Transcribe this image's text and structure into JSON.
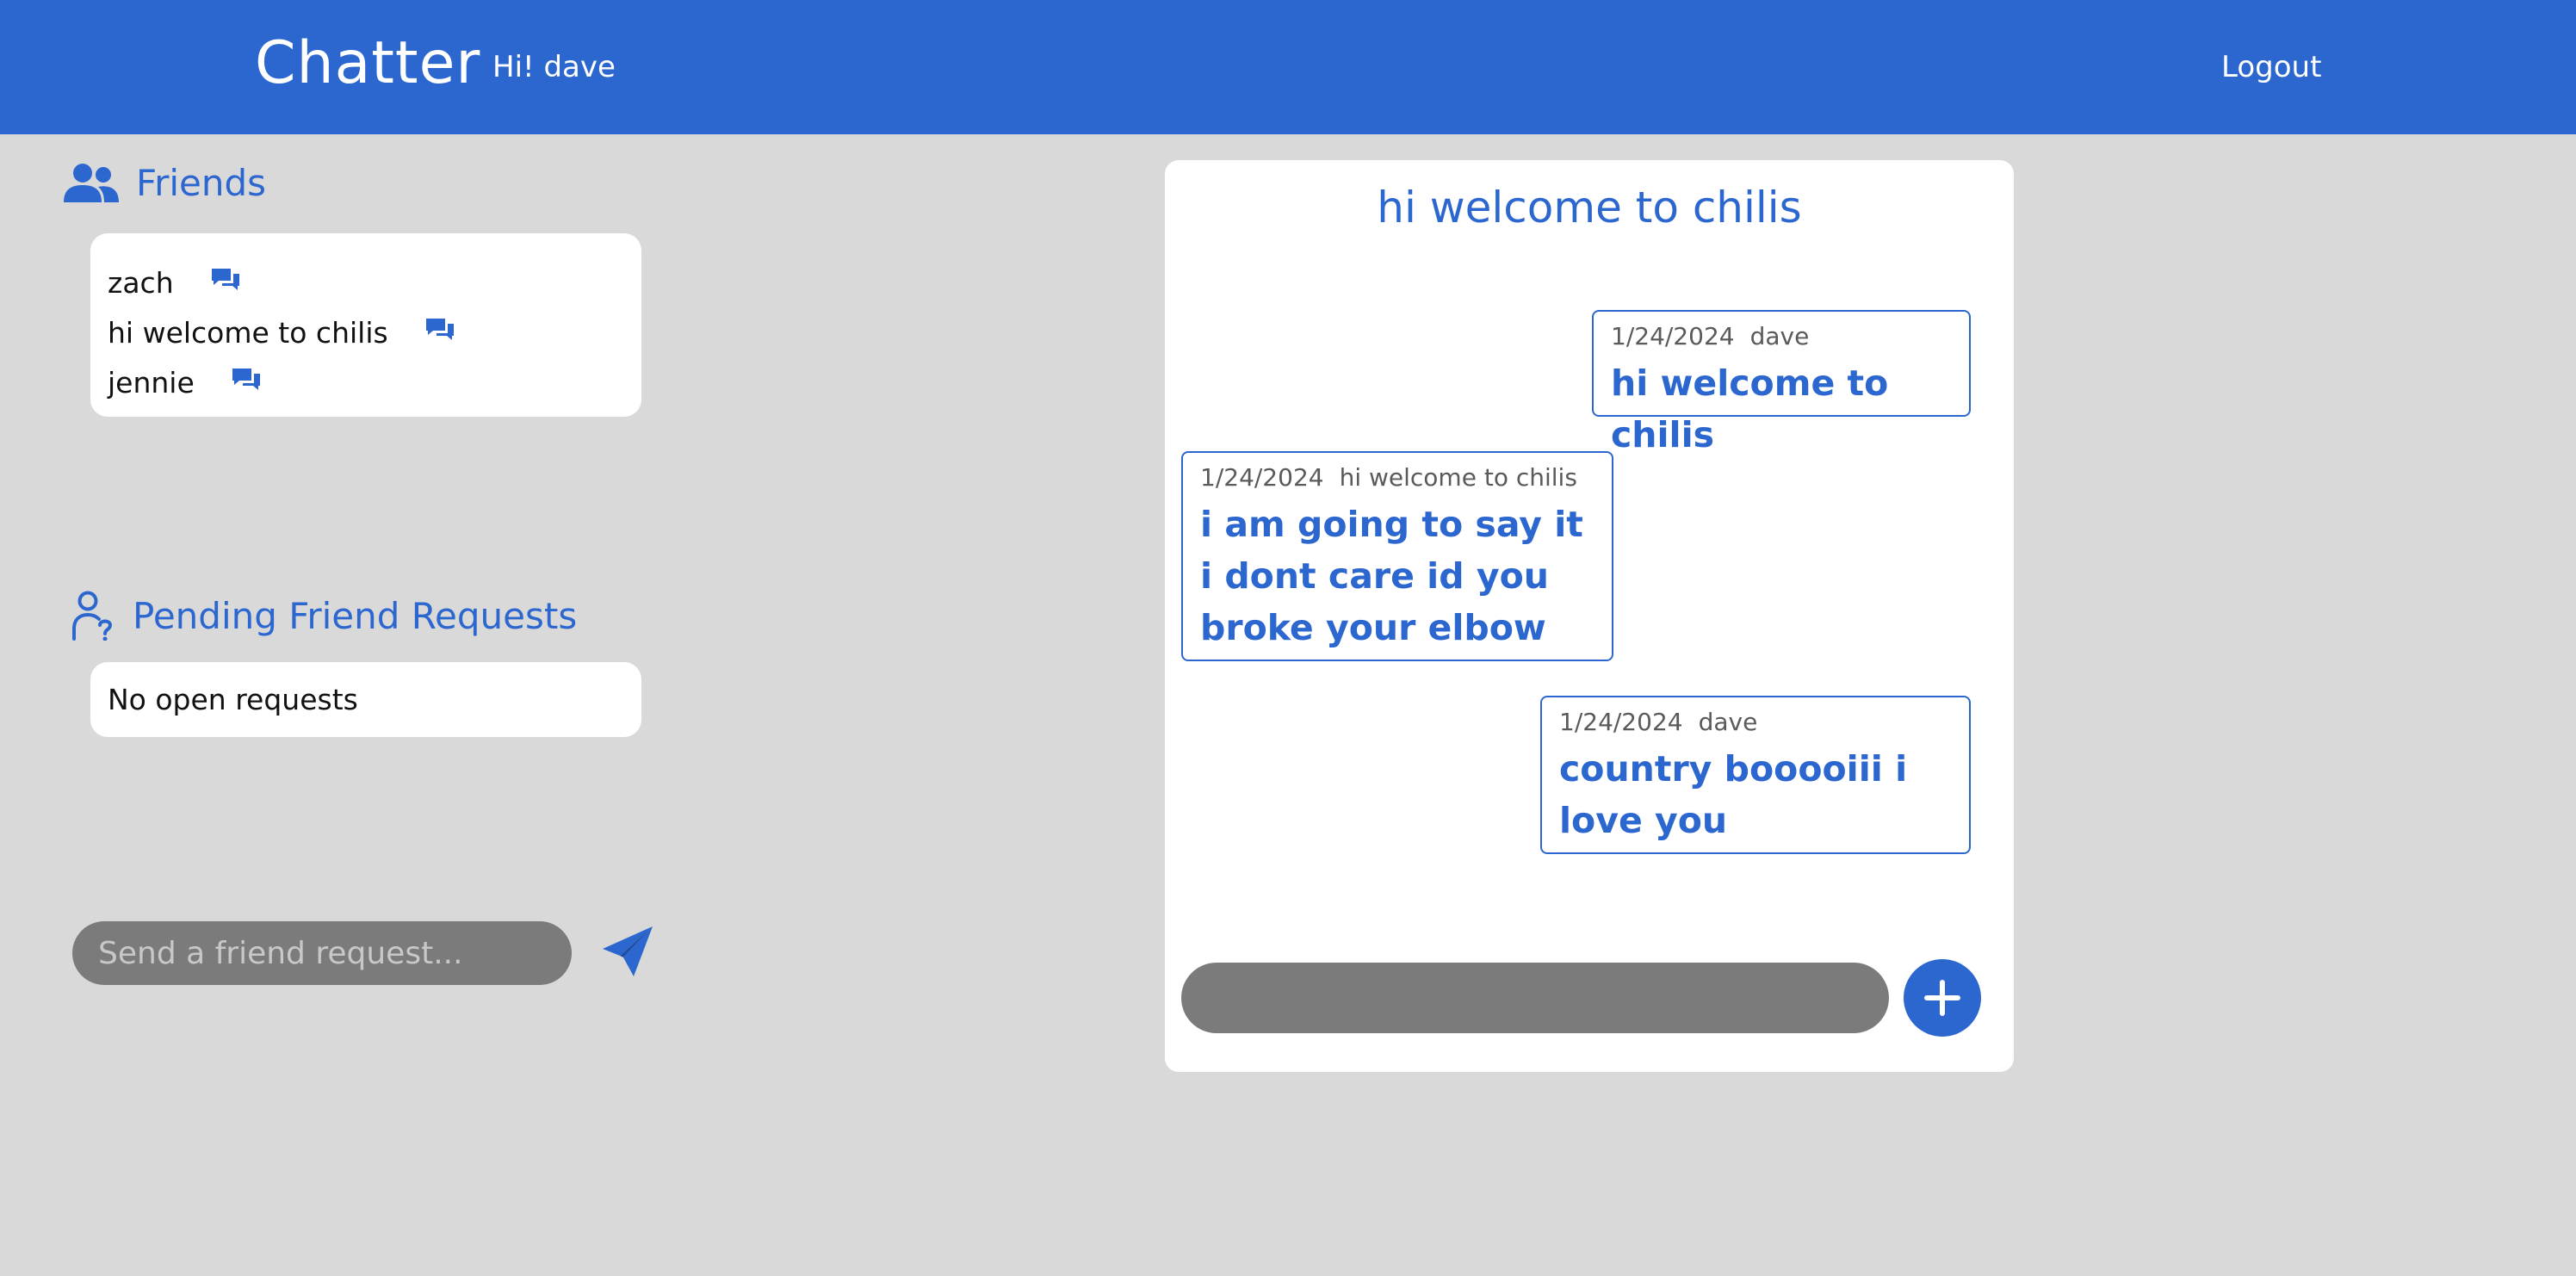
{
  "header": {
    "brand": "Chatter",
    "greeting": "Hi! dave",
    "logout_label": "Logout"
  },
  "friends": {
    "title": "Friends",
    "items": [
      {
        "name": "zach"
      },
      {
        "name": "hi welcome to chilis"
      },
      {
        "name": "jennie"
      }
    ]
  },
  "pending": {
    "title": "Pending Friend Requests",
    "empty_text": "No open requests"
  },
  "friend_request": {
    "placeholder": "Send a friend request..."
  },
  "chat": {
    "title": "hi welcome to chilis",
    "messages": [
      {
        "date": "1/24/2024",
        "sender": "dave",
        "text": "hi welcome to chilis"
      },
      {
        "date": "1/24/2024",
        "sender": "hi welcome to chilis",
        "text": "i am going to say it i dont care id you broke your elbow"
      },
      {
        "date": "1/24/2024",
        "sender": "dave",
        "text": "country booooiii i love you"
      }
    ],
    "input_value": ""
  },
  "colors": {
    "accent": "#2c67d0",
    "background": "#d9d9d9",
    "input_gray": "#7b7b7b"
  },
  "icons": [
    "users-icon",
    "chat-bubble-icon",
    "user-question-icon",
    "send-icon",
    "plus-icon"
  ]
}
